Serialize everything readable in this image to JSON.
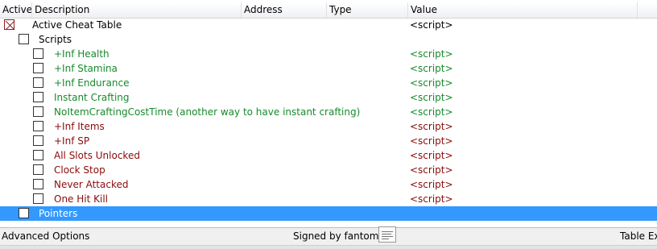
{
  "columns": {
    "active": "Active",
    "description": "Description",
    "address": "Address",
    "type": "Type",
    "value": "Value"
  },
  "root": {
    "description": "Active Cheat Table",
    "value": "<script>",
    "checkbox_state": "crossed"
  },
  "scripts_group": {
    "description": "Scripts",
    "value": ""
  },
  "entries": [
    {
      "description": "+Inf Health",
      "value": "<script>",
      "color": "#178a2c"
    },
    {
      "description": "+Inf Stamina",
      "value": "<script>",
      "color": "#178a2c"
    },
    {
      "description": "+Inf Endurance",
      "value": "<script>",
      "color": "#178a2c"
    },
    {
      "description": "Instant Crafting",
      "value": "<script>",
      "color": "#178a2c"
    },
    {
      "description": "NoItemCraftingCostTime (another way to have instant crafting)",
      "value": "<script>",
      "color": "#178a2c"
    },
    {
      "description": "+Inf Items",
      "value": "<script>",
      "color": "#8a0b0b"
    },
    {
      "description": "+Inf SP",
      "value": "<script>",
      "color": "#8a0b0b"
    },
    {
      "description": "All Slots Unlocked",
      "value": "<script>",
      "color": "#8a0b0b"
    },
    {
      "description": "Clock Stop",
      "value": "<script>",
      "color": "#8a0b0b"
    },
    {
      "description": "Never Attacked",
      "value": "<script>",
      "color": "#8a0b0b"
    },
    {
      "description": "One Hit Kill",
      "value": "<script>",
      "color": "#8a0b0b"
    }
  ],
  "pointers_group": {
    "description": "Pointers",
    "selected": true
  },
  "colors": {
    "selection": "#3399ff",
    "header_bg": "#eef0f3",
    "status_bg": "#f0f0f0"
  },
  "status_bar": {
    "advanced_options": "Advanced Options",
    "signed_by": "Signed by fantomas",
    "table_extras": "Table Ext"
  }
}
